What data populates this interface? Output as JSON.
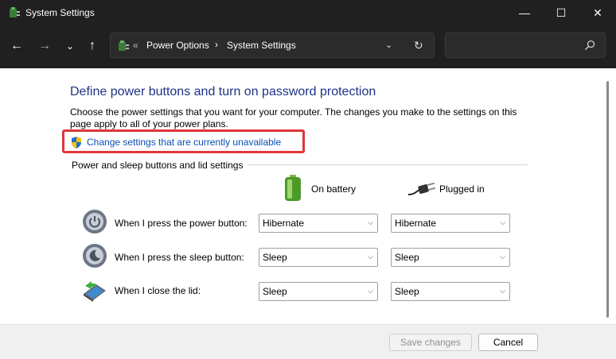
{
  "window": {
    "title": "System Settings"
  },
  "titlebar": {
    "minimize": "—",
    "maximize": "☐",
    "close": "✕"
  },
  "nav": {
    "back": "←",
    "forward": "→",
    "history": "⌄",
    "up": "↑"
  },
  "address": {
    "separator": "«",
    "crumbs": [
      "Power Options",
      "System Settings"
    ],
    "crumb_arrow": "›",
    "dropdown": "⌄",
    "refresh": "↻"
  },
  "search": {
    "placeholder": ""
  },
  "page": {
    "heading": "Define power buttons and turn on password protection",
    "description": "Choose the power settings that you want for your computer. The changes you make to the settings on this page apply to all of your power plans.",
    "change_link": "Change settings that are currently unavailable",
    "section_title": "Power and sleep buttons and lid settings",
    "columns": {
      "battery": "On battery",
      "plugged": "Plugged in"
    },
    "rows": [
      {
        "label": "When I press the power button:",
        "battery": "Hibernate",
        "plugged": "Hibernate",
        "icon": "power-button-icon"
      },
      {
        "label": "When I press the sleep button:",
        "battery": "Sleep",
        "plugged": "Sleep",
        "icon": "sleep-button-icon"
      },
      {
        "label": "When I close the lid:",
        "battery": "Sleep",
        "plugged": "Sleep",
        "icon": "laptop-lid-icon"
      }
    ]
  },
  "footer": {
    "save": "Save changes",
    "cancel": "Cancel"
  },
  "colors": {
    "heading": "#1e3287",
    "link": "#0a4fb4",
    "highlight": "#e0363a",
    "titlebar": "#202020"
  }
}
